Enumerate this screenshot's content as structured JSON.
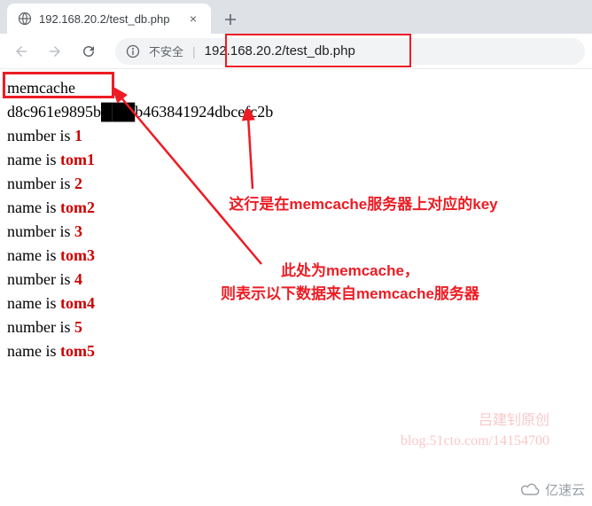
{
  "browser": {
    "tab_title": "192.168.20.2/test_db.php",
    "new_tab_plus": "+",
    "tab_close": "×",
    "security_label": "不安全",
    "url": "192.168.20.2/test_db.php"
  },
  "content": {
    "source_label": "memcache",
    "hash_key": "d8c961e9895b███b463841924dbcefc2b",
    "pairs": [
      {
        "number_label": "number is ",
        "number": "1",
        "name_label": "name is ",
        "name": "tom1"
      },
      {
        "number_label": "number is ",
        "number": "2",
        "name_label": "name is ",
        "name": "tom2"
      },
      {
        "number_label": "number is ",
        "number": "3",
        "name_label": "name is ",
        "name": "tom3"
      },
      {
        "number_label": "number is ",
        "number": "4",
        "name_label": "name is ",
        "name": "tom4"
      },
      {
        "number_label": "number is ",
        "number": "5",
        "name_label": "name is ",
        "name": "tom5"
      }
    ]
  },
  "annotations": {
    "key_note": "这行是在memcache服务器上对应的key",
    "memcache_note_line1": "此处为memcache，",
    "memcache_note_line2": "则表示以下数据来自memcache服务器"
  },
  "watermark": {
    "author": "吕建钊原创",
    "blog": "blog.51cto.com/14154700"
  },
  "logo": {
    "text": "亿速云"
  }
}
